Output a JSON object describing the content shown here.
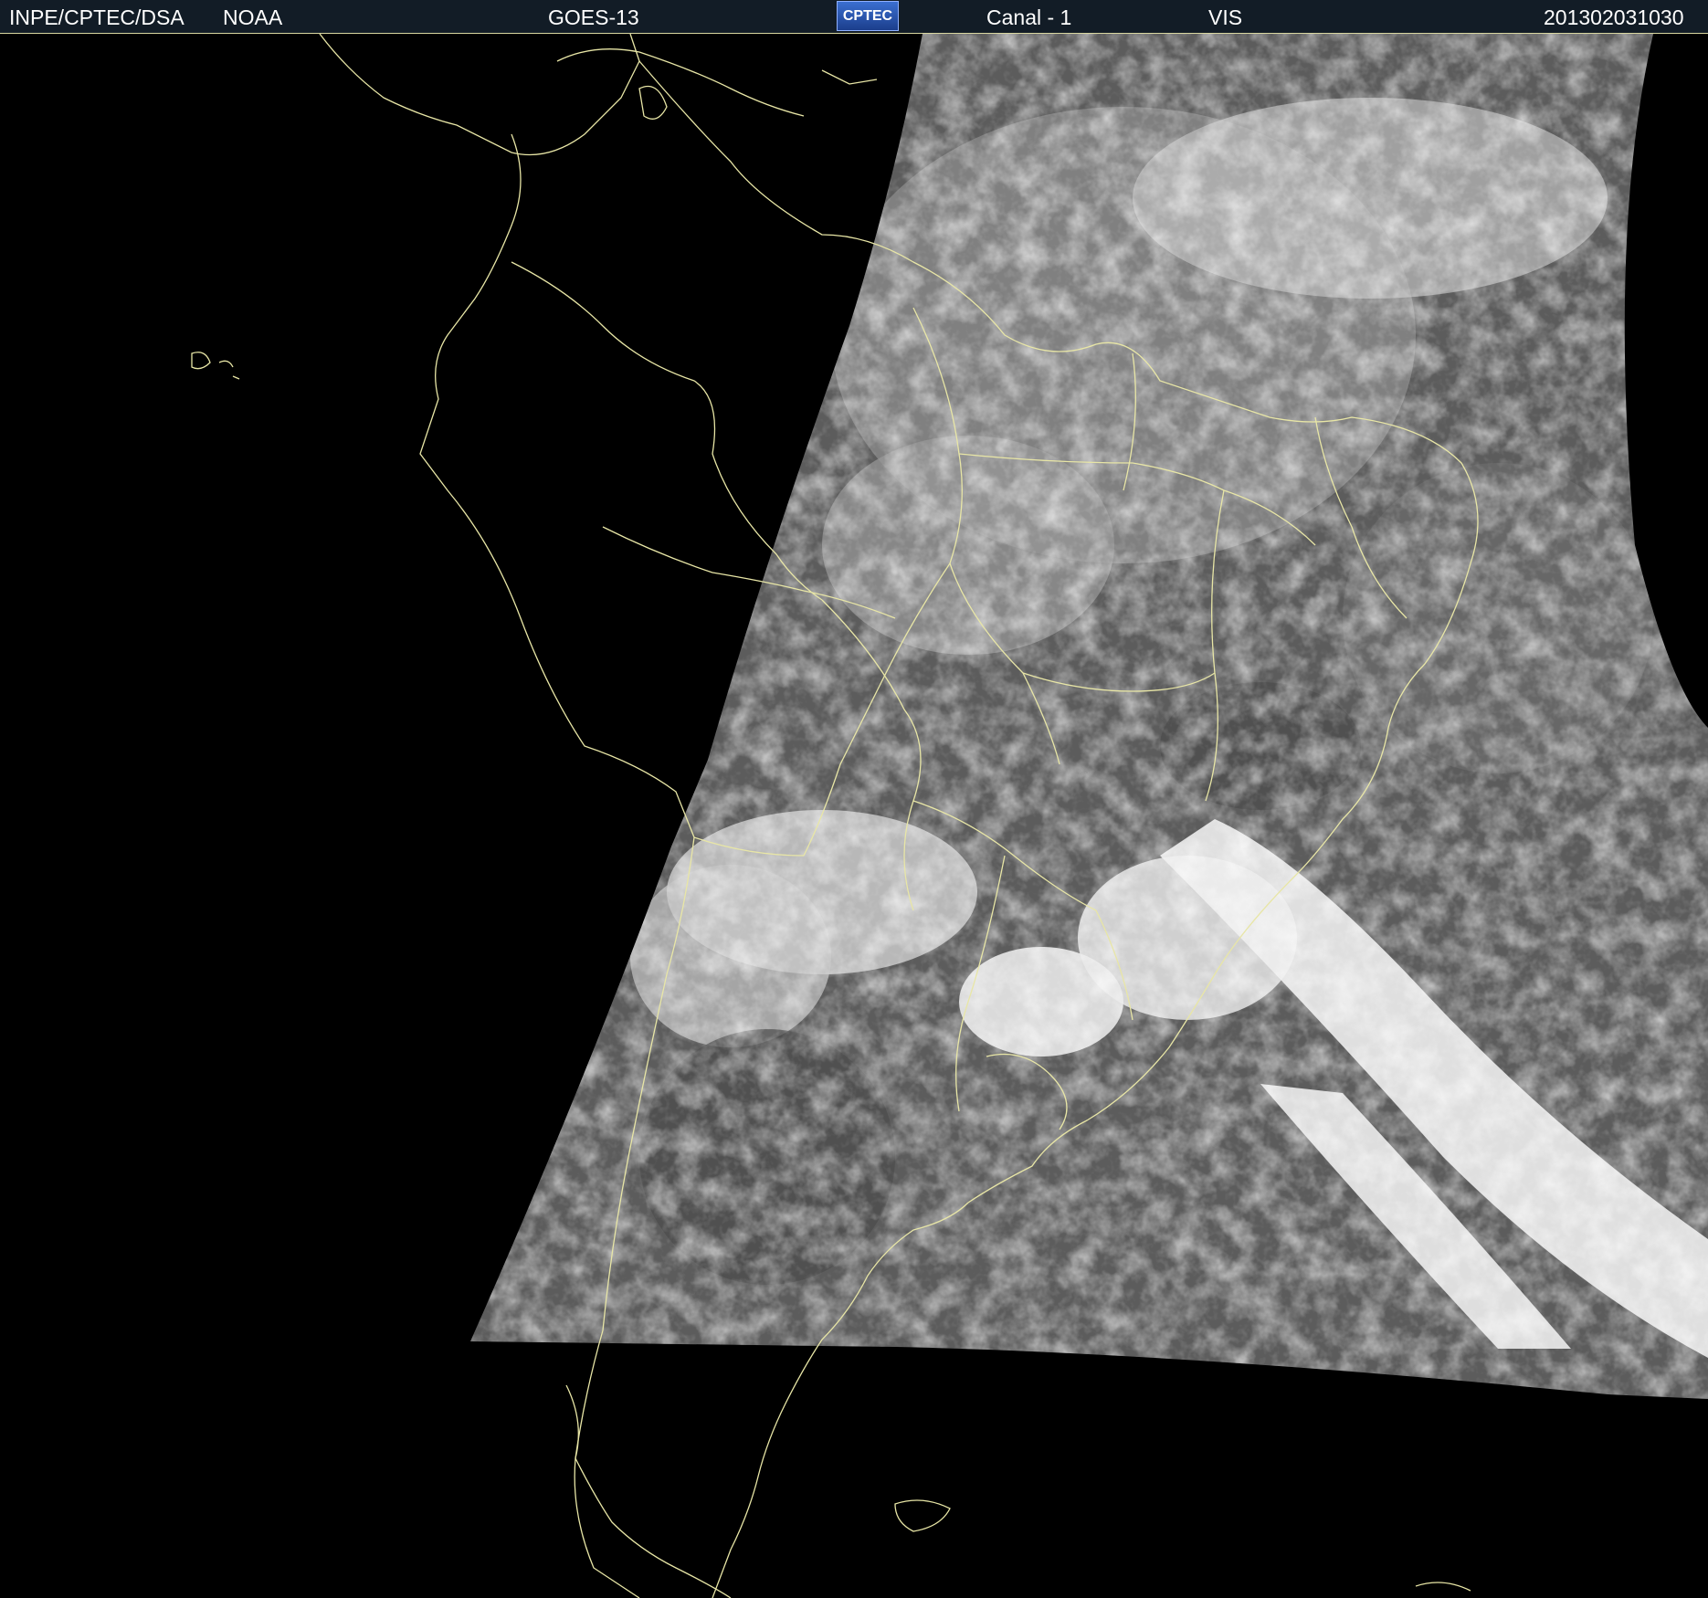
{
  "header": {
    "agency": "INPE/CPTEC/DSA",
    "source": "NOAA",
    "satellite": "GOES-13",
    "logo_text": "CPTEC",
    "channel": "Canal - 1",
    "band": "VIS",
    "timestamp": "201302031030"
  },
  "colors": {
    "background": "#000000",
    "header_bg": "#121c26",
    "coastline": "#e8e6a6",
    "cloud": "#f2f2f2",
    "ocean_land": "#6a6a6a"
  },
  "map": {
    "icon": "satellite-image"
  }
}
